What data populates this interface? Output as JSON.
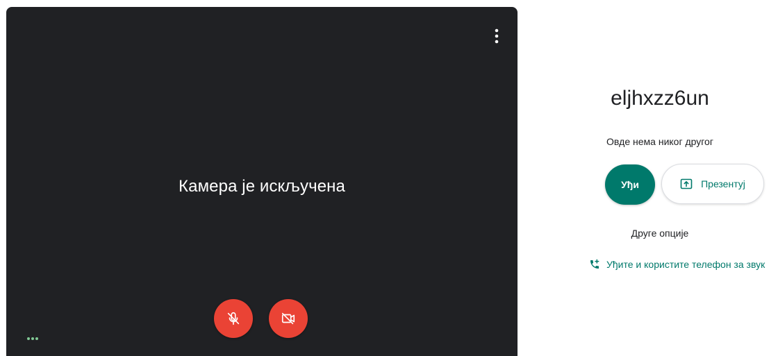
{
  "preview": {
    "camera_off_text": "Камера је искључена",
    "more_icon": "more-vert-icon",
    "mic_icon": "mic-off-icon",
    "camera_icon": "videocam-off-icon",
    "dots_icon": "more-horiz-icon",
    "background_color": "#202124",
    "button_color": "#ea4335"
  },
  "join_panel": {
    "meeting_code": "eljhxzz6un",
    "status_text": "Овде нема никог другог",
    "join_label": "Уђи",
    "present_label": "Презентуј",
    "present_icon": "present-to-all-icon",
    "other_options_label": "Друге опције",
    "phone_link_label": "Уђите и користите телефон за звук",
    "phone_icon": "phone-add-icon",
    "accent_color": "#00796b"
  }
}
